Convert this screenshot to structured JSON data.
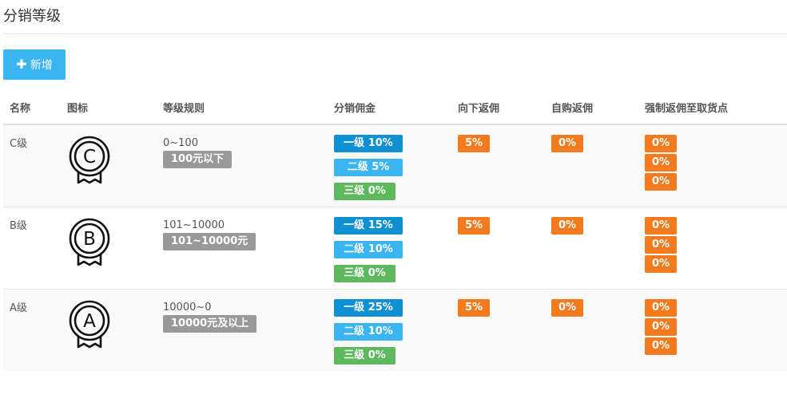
{
  "page": {
    "title": "分销等级"
  },
  "toolbar": {
    "add_label": "新增"
  },
  "table": {
    "headers": [
      "名称",
      "图标",
      "等级规则",
      "分销佣金",
      "向下返佣",
      "自购返佣",
      "强制返佣至取货点"
    ],
    "rows": [
      {
        "name": "C级",
        "icon_letter": "C",
        "rule_range": "0~100",
        "rule_desc": "100元以下",
        "commissions": [
          "一级 10%",
          "二级 5%",
          "三级 0%"
        ],
        "down_rebate": "5%",
        "self_rebate": "0%",
        "force_rebate": [
          "0%",
          "0%",
          "0%"
        ]
      },
      {
        "name": "B级",
        "icon_letter": "B",
        "rule_range": "101~10000",
        "rule_desc": "101~10000元",
        "commissions": [
          "一级 15%",
          "二级 10%",
          "三级 0%"
        ],
        "down_rebate": "5%",
        "self_rebate": "0%",
        "force_rebate": [
          "0%",
          "0%",
          "0%"
        ]
      },
      {
        "name": "A级",
        "icon_letter": "A",
        "rule_range": "10000~0",
        "rule_desc": "10000元及以上",
        "commissions": [
          "一级 25%",
          "二级 10%",
          "三级 0%"
        ],
        "down_rebate": "5%",
        "self_rebate": "0%",
        "force_rebate": [
          "0%",
          "0%",
          "0%"
        ]
      }
    ]
  },
  "colors": {
    "primary": "#3bb4f2",
    "level1": "#0e90d2",
    "level3": "#5eb95e",
    "orange": "#f37b1d",
    "gray": "#999999"
  }
}
